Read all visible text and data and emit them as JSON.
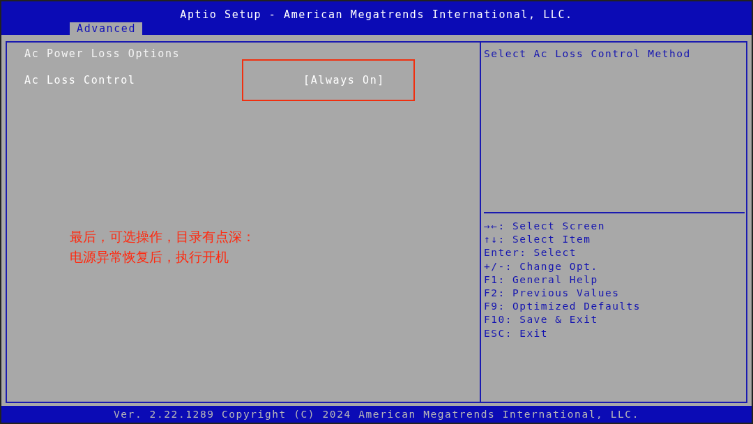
{
  "window": {
    "title": "Aptio Setup - American Megatrends International, LLC."
  },
  "tabs": [
    {
      "label": "Advanced",
      "selected": true
    }
  ],
  "settings": {
    "section_title": "Ac Power Loss Options",
    "items": [
      {
        "label": "Ac Loss Control",
        "value": "[Always On]",
        "selected": true
      }
    ]
  },
  "help": {
    "description": "Select Ac Loss Control Method",
    "keys": [
      "→←: Select Screen",
      "↑↓: Select Item",
      "Enter: Select",
      "+/-: Change Opt.",
      "F1: General Help",
      "F2: Previous Values",
      "F9: Optimized Defaults",
      "F10: Save & Exit",
      "ESC: Exit"
    ]
  },
  "annotation": {
    "lines": [
      "最后，可选操作，目录有点深：",
      "电源异常恢复后，执行开机"
    ]
  },
  "status_bar": "Ver. 2.22.1289 Copyright (C) 2024 American Megatrends International, LLC."
}
